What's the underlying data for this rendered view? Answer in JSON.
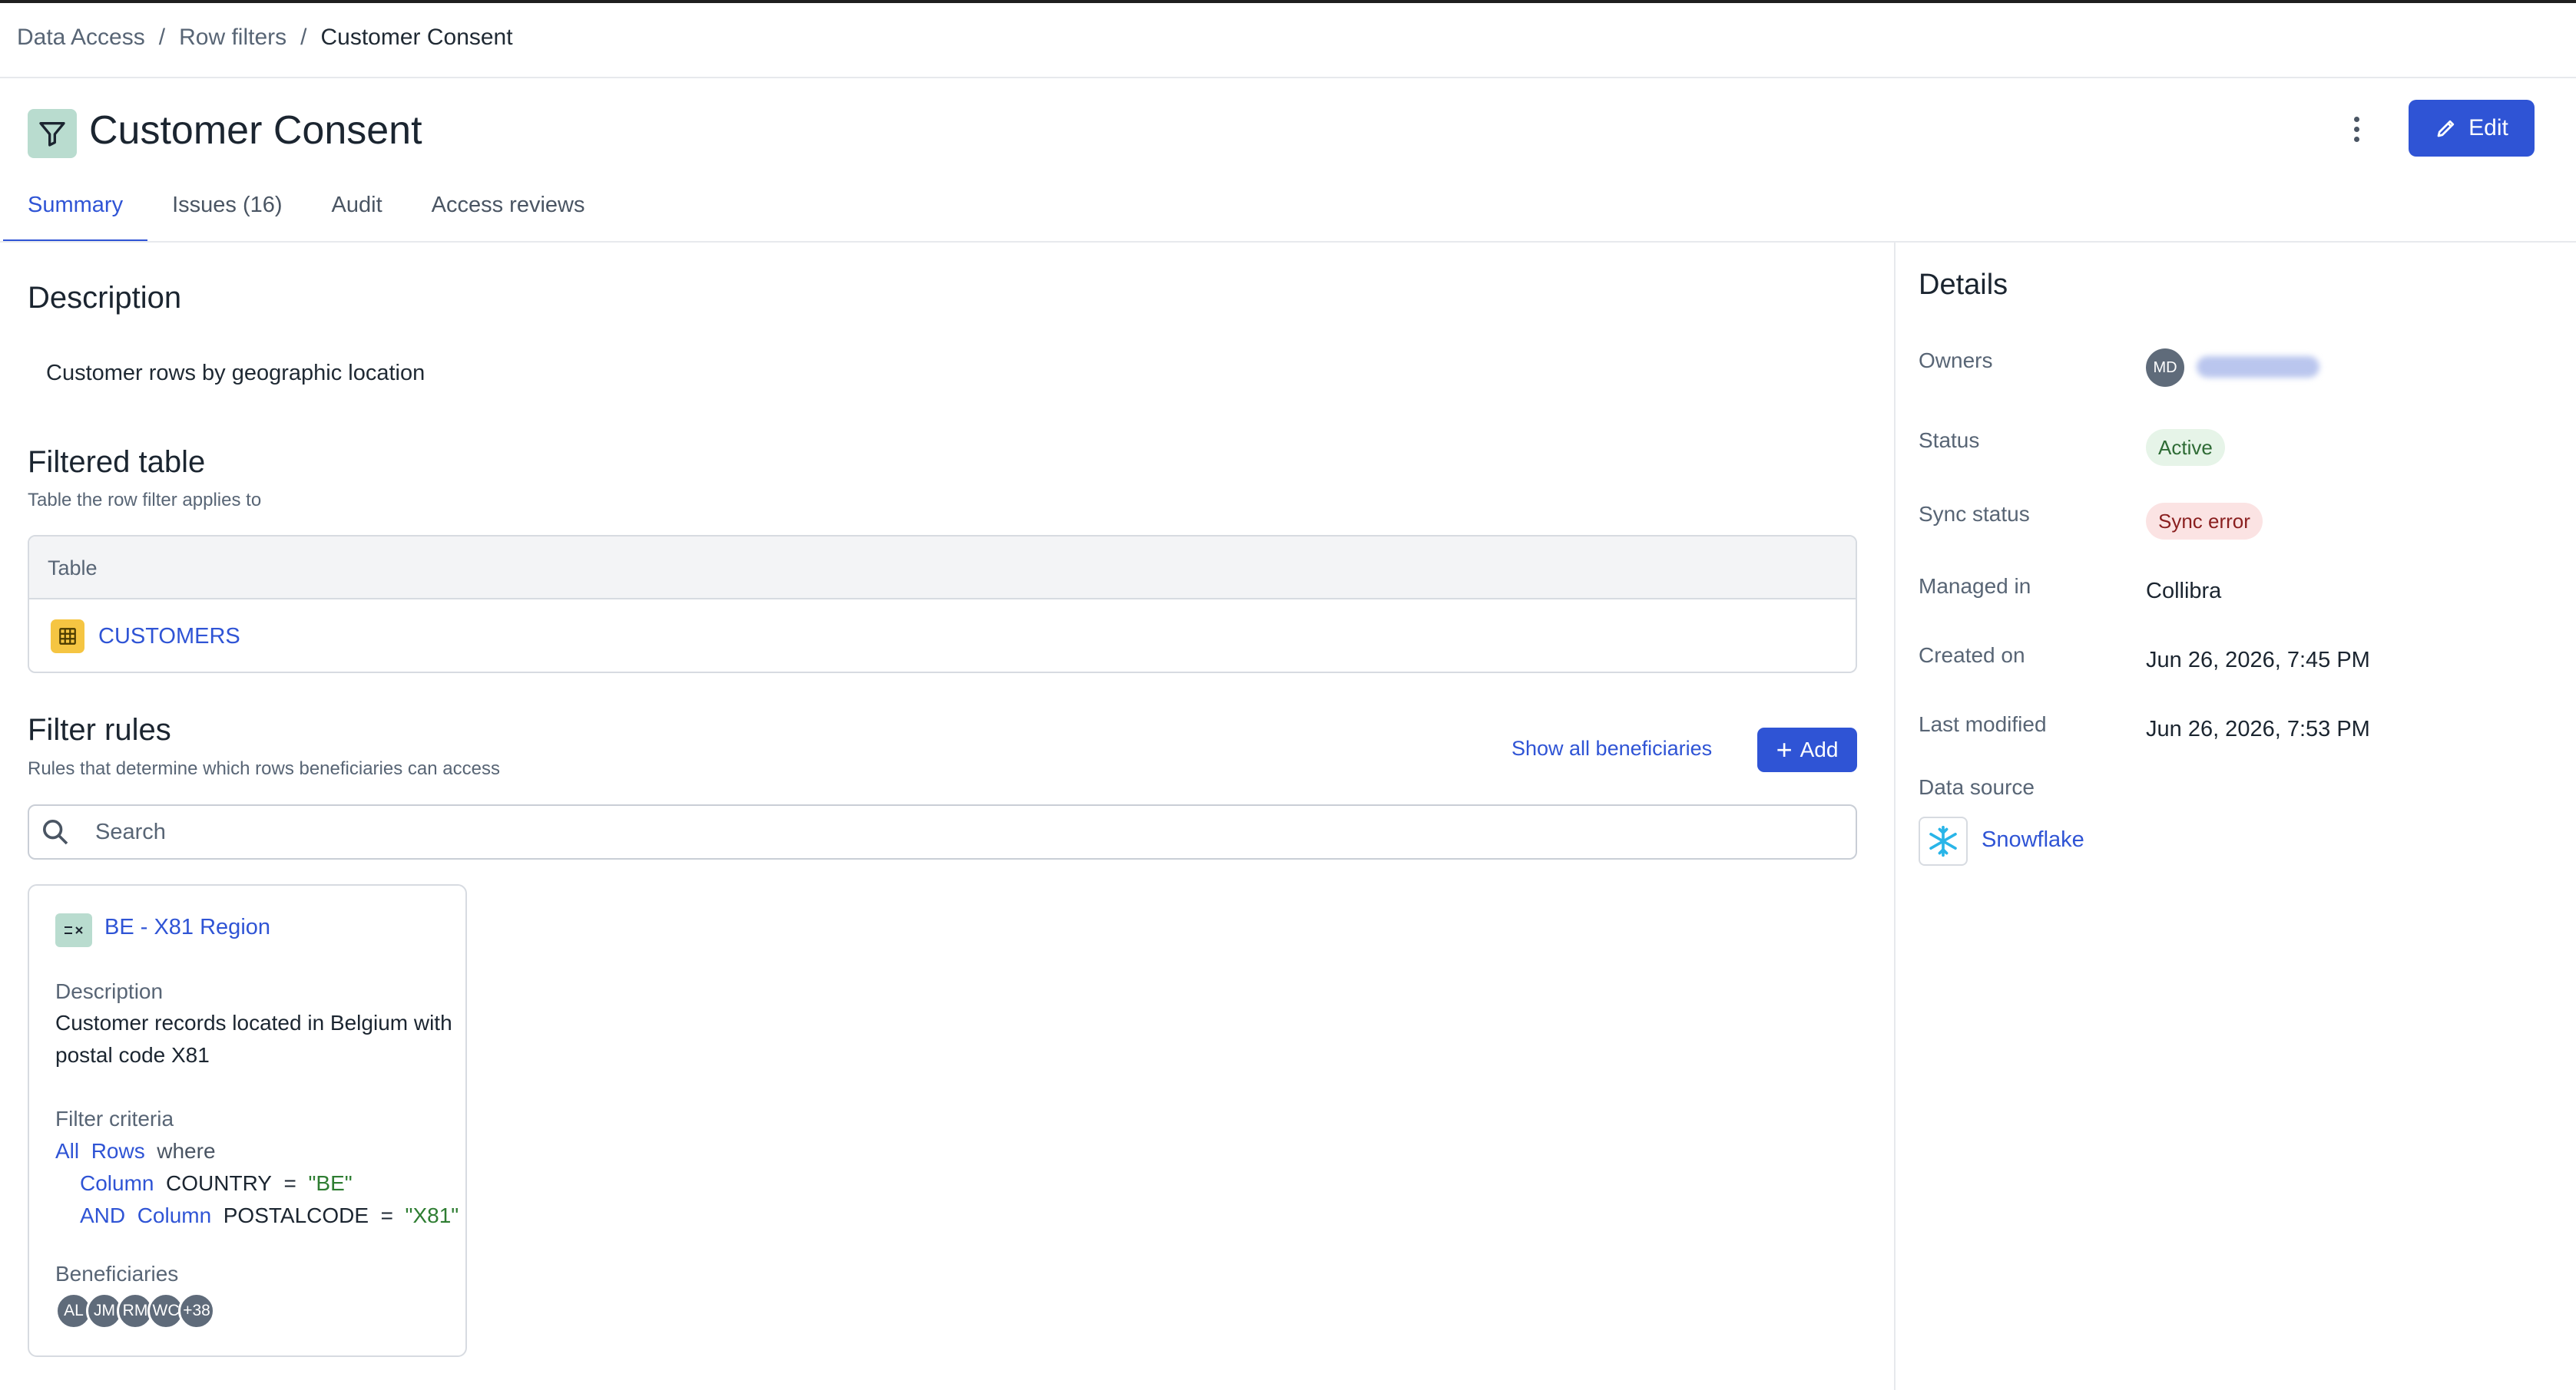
{
  "breadcrumb": {
    "items": [
      "Data Access",
      "Row filters"
    ],
    "current": "Customer Consent",
    "separator": "/"
  },
  "header": {
    "title": "Customer Consent",
    "edit_label": "Edit"
  },
  "tabs": [
    {
      "label": "Summary"
    },
    {
      "label": "Issues (16)"
    },
    {
      "label": "Audit"
    },
    {
      "label": "Access reviews"
    }
  ],
  "description": {
    "title": "Description",
    "text": "Customer rows by geographic location"
  },
  "filtered_table": {
    "title": "Filtered table",
    "subtitle": "Table the row filter applies to",
    "column_header": "Table",
    "rows": [
      {
        "name": "CUSTOMERS"
      }
    ]
  },
  "filter_rules": {
    "title": "Filter rules",
    "subtitle": "Rules that determine which rows beneficiaries can access",
    "show_all_label": "Show all beneficiaries",
    "add_label": "Add",
    "search_placeholder": "Search",
    "rules": [
      {
        "name": "BE - X81 Region",
        "description_label": "Description",
        "description": "Customer records located in Belgium with postal code X81",
        "criteria_label": "Filter criteria",
        "criteria": {
          "all": "All",
          "rows": "Rows",
          "where": "where",
          "line1": {
            "kw": "Column",
            "field": "COUNTRY",
            "op": "=",
            "value": "\"BE\""
          },
          "line2": {
            "conj": "AND",
            "kw": "Column",
            "field": "POSTALCODE",
            "op": "=",
            "value": "\"X81\""
          }
        },
        "beneficiaries_label": "Beneficiaries",
        "beneficiaries": [
          "AL",
          "JM",
          "RM",
          "WC",
          "+38"
        ]
      }
    ]
  },
  "details": {
    "title": "Details",
    "owners_label": "Owners",
    "owner_initials": "MD",
    "status_label": "Status",
    "status_value": "Active",
    "sync_label": "Sync status",
    "sync_value": "Sync error",
    "managed_label": "Managed in",
    "managed_value": "Collibra",
    "created_label": "Created on",
    "created_value": "Jun 26, 2026, 7:45 PM",
    "modified_label": "Last modified",
    "modified_value": "Jun 26, 2026, 7:53 PM",
    "source_label": "Data source",
    "source_value": "Snowflake"
  },
  "colors": {
    "accent": "#2f54d5",
    "active_bg": "#e6f4e8",
    "error_bg": "#fbe3e3",
    "table_icon": "#f5c542",
    "title_icon_bg": "#b9dccf"
  }
}
